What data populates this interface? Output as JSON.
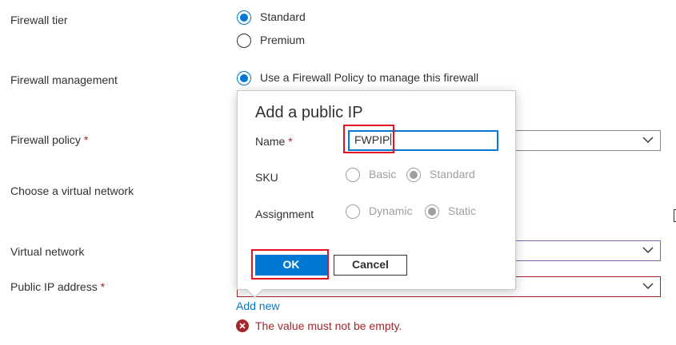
{
  "form": {
    "firewall_tier": {
      "label": "Firewall tier",
      "options": [
        {
          "label": "Standard",
          "selected": true
        },
        {
          "label": "Premium",
          "selected": false
        }
      ]
    },
    "firewall_management": {
      "label": "Firewall management",
      "option": "Use a Firewall Policy to manage this firewall"
    },
    "firewall_policy": {
      "label": "Firewall policy",
      "required_mark": "*"
    },
    "choose_vnet": {
      "label": "Choose a virtual network"
    },
    "virtual_network": {
      "label": "Virtual network"
    },
    "public_ip": {
      "label": "Public IP address",
      "required_mark": "*",
      "add_new": "Add new",
      "error": "The value must not be empty."
    }
  },
  "dialog": {
    "title": "Add a public IP",
    "name_label": "Name",
    "name_required": "*",
    "name_value": "FWPIP",
    "sku": {
      "label": "SKU",
      "options": [
        {
          "label": "Basic",
          "selected": false
        },
        {
          "label": "Standard",
          "selected": true
        }
      ]
    },
    "assignment": {
      "label": "Assignment",
      "options": [
        {
          "label": "Dynamic",
          "selected": false
        },
        {
          "label": "Static",
          "selected": true
        }
      ]
    },
    "ok_label": "OK",
    "cancel_label": "Cancel"
  },
  "colors": {
    "accent": "#0078d4",
    "highlight": "#e81123",
    "error": "#a4262c",
    "disabled": "#a19f9d"
  }
}
